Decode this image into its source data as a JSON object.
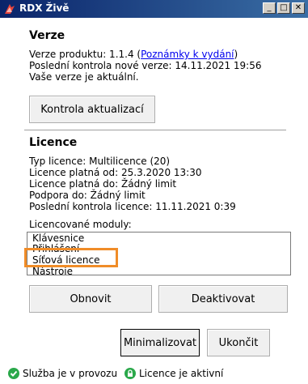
{
  "window": {
    "title": "RDX Živě",
    "icon": "rdx-logo-icon",
    "controls": {
      "minimize": "_",
      "maximize": "□",
      "close": "✕"
    }
  },
  "version": {
    "heading": "Verze",
    "product_version_prefix": "Verze produktu: 1.1.4 (",
    "release_notes_link": "Poznámky k vydání",
    "product_version_suffix": ")",
    "last_check": "Poslední kontrola nové verze: 14.11.2021 19:56",
    "status": "Vaše verze je aktuální.",
    "check_button": "Kontrola aktualizací"
  },
  "license": {
    "heading": "Licence",
    "type": "Typ licence: Multilicence (20)",
    "valid_from": "Licence platná od: 25.3.2020 13:30",
    "valid_to": "Licence platná do: Žádný limit",
    "support_to": "Podpora do: Žádný limit",
    "last_check": "Poslední kontrola licence: 11.11.2021 0:39",
    "modules_label": "Licencované moduly:",
    "modules": [
      "Klávesnice",
      "Přihlášení",
      "Síťová licence",
      "Nástroje"
    ],
    "refresh_button": "Obnovit",
    "deactivate_button": "Deaktivovat"
  },
  "footer": {
    "minimize_button": "Minimalizovat",
    "exit_button": "Ukončit",
    "service_status": "Služba je v provozu",
    "license_status": "Licence je aktivní"
  },
  "colors": {
    "highlight": "#f08c28",
    "status_ok": "#2aa84a",
    "link": "#0000ee"
  }
}
